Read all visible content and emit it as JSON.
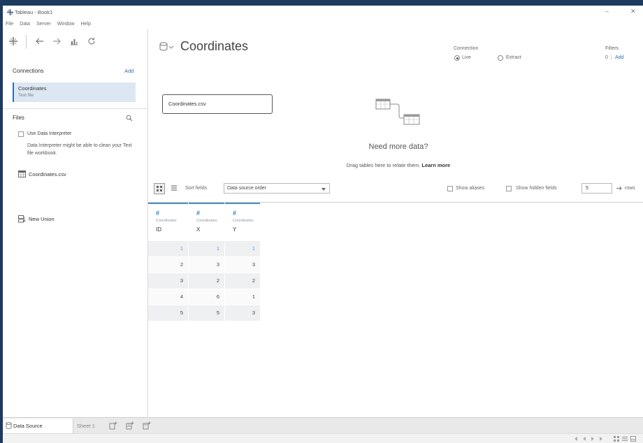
{
  "window": {
    "title": "Tableau - Book1",
    "minimize_glyph": "–",
    "close_glyph": "✕"
  },
  "menu": {
    "items": [
      "File",
      "Data",
      "Server",
      "Window",
      "Help"
    ]
  },
  "toolbar": {
    "icons": [
      "tableau-logo-icon",
      "back-arrow-icon",
      "forward-arrow-icon",
      "new-data-source-icon",
      "refresh-icon"
    ]
  },
  "connections": {
    "header": "Connections",
    "add_label": "Add",
    "items": [
      {
        "name": "Coordinates",
        "type": "Text file"
      }
    ]
  },
  "files": {
    "header": "Files",
    "interpreter_label": "Use Data Interpreter",
    "interpreter_checked": false,
    "interpreter_description": "Data Interpreter might be able to clean your Text file workbook.",
    "items": [
      "Coordinates.csv"
    ],
    "new_union_label": "New Union"
  },
  "datasource": {
    "title": "Coordinates",
    "connection_label": "Connection",
    "connection_options": [
      "Live",
      "Extract"
    ],
    "connection_selected": "Live",
    "filters_label": "Filters",
    "filters_count": "0",
    "filters_separator": "|",
    "filters_add": "Add"
  },
  "canvas": {
    "table_name": "Coordinates.csv",
    "need_more_title": "Need more data?",
    "drag_hint": "Drag tables here to relate them.",
    "learn_more": "Learn more"
  },
  "grid_toolbar": {
    "sort_label": "Sort fields",
    "sort_value": "Data source order",
    "show_aliases_label": "Show aliases",
    "show_hidden_label": "Show hidden fields",
    "rows_value": "5",
    "rows_label": "rows"
  },
  "grid": {
    "columns": [
      {
        "type_icon": "#",
        "source": "Coordinates",
        "name": "ID"
      },
      {
        "type_icon": "#",
        "source": "Coordinates",
        "name": "X"
      },
      {
        "type_icon": "#",
        "source": "Coordinates",
        "name": "Y"
      }
    ],
    "rows": [
      [
        1,
        1,
        1
      ],
      [
        2,
        3,
        3
      ],
      [
        3,
        2,
        2
      ],
      [
        4,
        6,
        1
      ],
      [
        5,
        5,
        3
      ]
    ]
  },
  "tabs": {
    "data_source": "Data Source",
    "sheet": "Sheet 1"
  },
  "status": {
    "icons": [
      "first-page-icon",
      "prev-page-icon",
      "next-page-icon",
      "last-page-icon",
      "grid-view-icon",
      "list-view-icon",
      "filmstrip-icon"
    ]
  },
  "colors": {
    "frame": "#1e3a5f",
    "accent": "#2f6db5",
    "header_bar": "#4a90d0",
    "selection": "#dce7f3"
  }
}
